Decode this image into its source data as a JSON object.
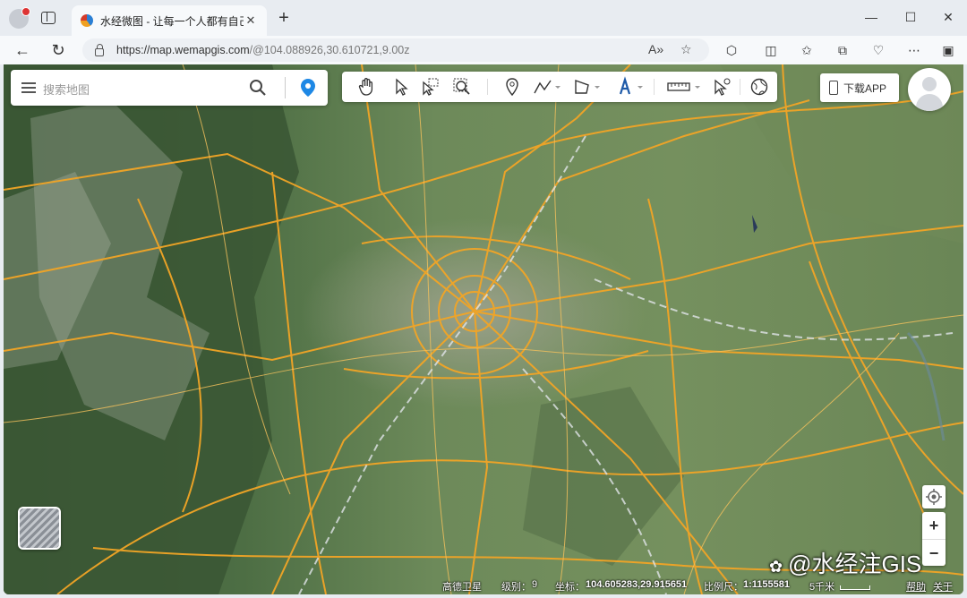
{
  "browser": {
    "tab_title": "水经微图 - 让每一个人都有自己的",
    "url_host": "https://map.wemapgis.com",
    "url_path": "/@104.088926,30.610721,9.00z"
  },
  "search": {
    "placeholder": "搜索地图"
  },
  "header": {
    "download_label": "下载APP"
  },
  "tools": [
    {
      "icon": "pan-hand-icon"
    },
    {
      "icon": "select-arrow-icon"
    },
    {
      "icon": "box-select-icon"
    },
    {
      "icon": "zoom-box-icon"
    },
    {
      "icon": "marker-pin-icon"
    },
    {
      "icon": "polyline-icon"
    },
    {
      "icon": "polygon-icon"
    },
    {
      "icon": "text-tool-icon"
    },
    {
      "icon": "measure-ruler-icon"
    },
    {
      "icon": "identify-cursor-icon"
    },
    {
      "icon": "globe-icon"
    }
  ],
  "zoom": {
    "in_label": "+",
    "out_label": "−"
  },
  "status": {
    "layer": "高德卫星",
    "level_label": "级别：",
    "level": "9",
    "coord_label": "坐标：",
    "coord": "104.605283,29.915651",
    "scale_label": "比例尺：",
    "scale": "1:1155581",
    "distance": "5千米",
    "help": "帮助",
    "about": "关于"
  },
  "watermark": "@水经注GIS",
  "colors": {
    "accent": "#1e88e5",
    "road": "#f0a020"
  }
}
